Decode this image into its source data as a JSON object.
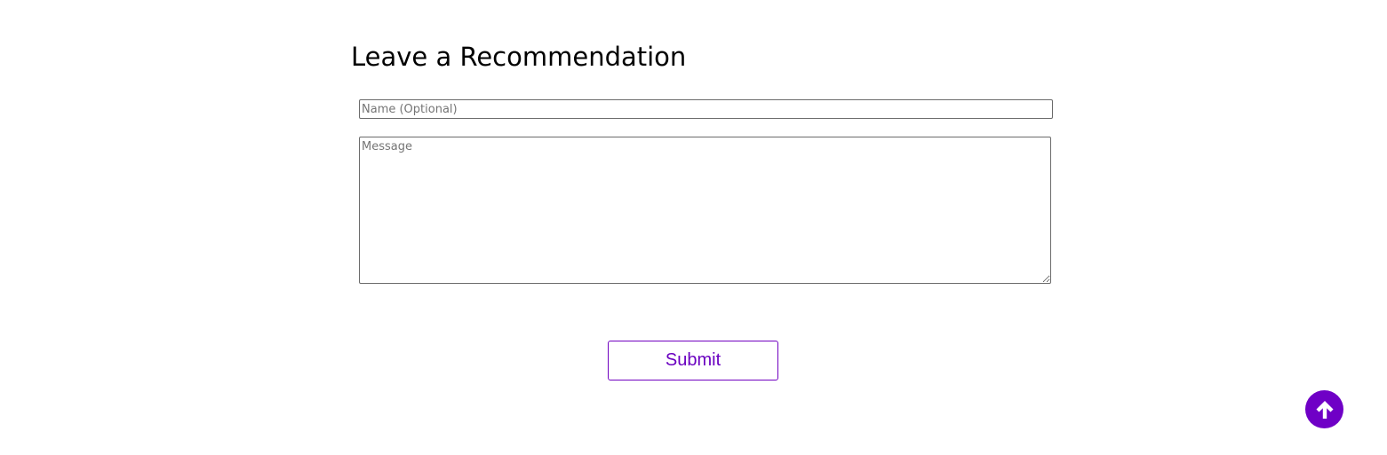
{
  "section": {
    "title": "Leave a Recommendation"
  },
  "form": {
    "name_placeholder": "Name (Optional)",
    "name_value": "",
    "message_placeholder": "Message",
    "message_value": "",
    "submit_label": "Submit"
  },
  "scroll_top": {
    "icon": "arrow-up-icon"
  },
  "colors": {
    "accent": "#6f00c6",
    "background": "#ffffff",
    "text": "#000000"
  }
}
